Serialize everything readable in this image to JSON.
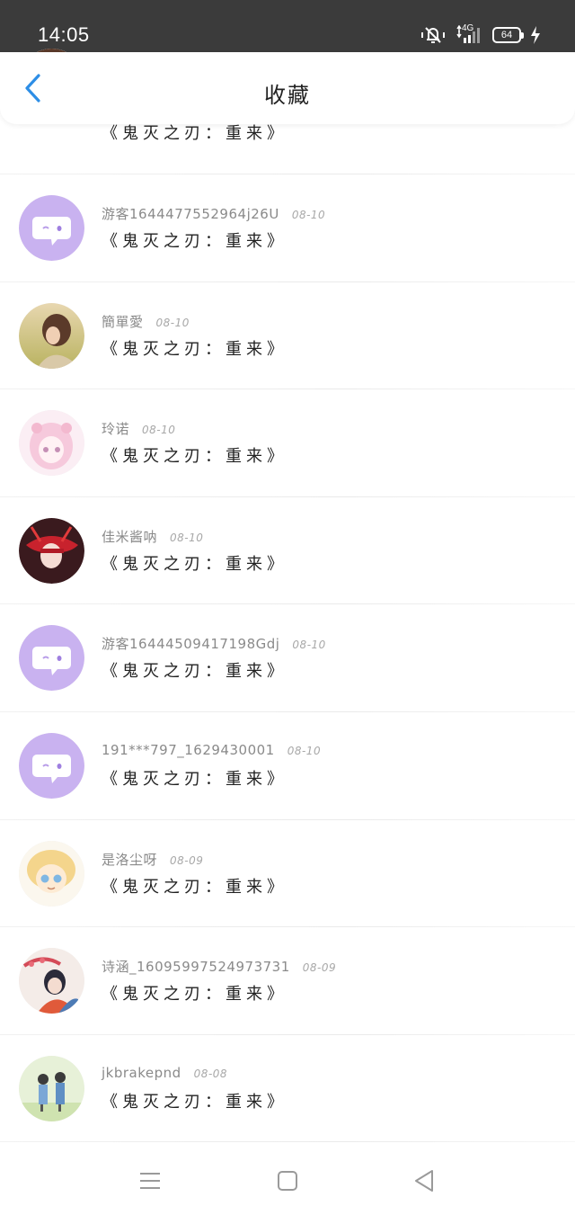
{
  "status_bar": {
    "time": "14:05",
    "network": "4G",
    "battery": "64",
    "icons": [
      "mute-vibrate-icon",
      "signal-4g-icon",
      "battery-icon",
      "charging-icon"
    ]
  },
  "header": {
    "title": "收藏",
    "back_icon": "chevron-left-icon",
    "accent_color": "#2d8ee6"
  },
  "items": [
    {
      "username": "",
      "date": "",
      "content": "《鬼灭之刃：重来》",
      "avatar": "cartoon-group"
    },
    {
      "username": "游客1644477552964j26U",
      "date": "08-10",
      "content": "《鬼灭之刃：重来》",
      "avatar": "default-chat"
    },
    {
      "username": "簡單愛",
      "date": "08-10",
      "content": "《鬼灭之刃：重来》",
      "avatar": "photo-girl"
    },
    {
      "username": "玲诺",
      "date": "08-10",
      "content": "《鬼灭之刃：重来》",
      "avatar": "anime-pink"
    },
    {
      "username": "佳米酱呐",
      "date": "08-10",
      "content": "《鬼灭之刃：重来》",
      "avatar": "anime-red"
    },
    {
      "username": "游客16444509417198Gdj",
      "date": "08-10",
      "content": "《鬼灭之刃：重来》",
      "avatar": "default-chat"
    },
    {
      "username": "191***797_1629430001",
      "date": "08-10",
      "content": "《鬼灭之刃：重来》",
      "avatar": "default-chat"
    },
    {
      "username": "是洛尘呀",
      "date": "08-09",
      "content": "《鬼灭之刃：重来》",
      "avatar": "anime-yellow"
    },
    {
      "username": "诗涵_16095997524973731",
      "date": "08-09",
      "content": "《鬼灭之刃：重来》",
      "avatar": "anime-blossom"
    },
    {
      "username": "jkbrakepnd",
      "date": "08-08",
      "content": "《鬼灭之刃：重来》",
      "avatar": "cartoon-couple"
    }
  ],
  "nav": {
    "menu_icon": "menu-icon",
    "home_icon": "square-home-icon",
    "back_icon": "triangle-back-icon"
  }
}
